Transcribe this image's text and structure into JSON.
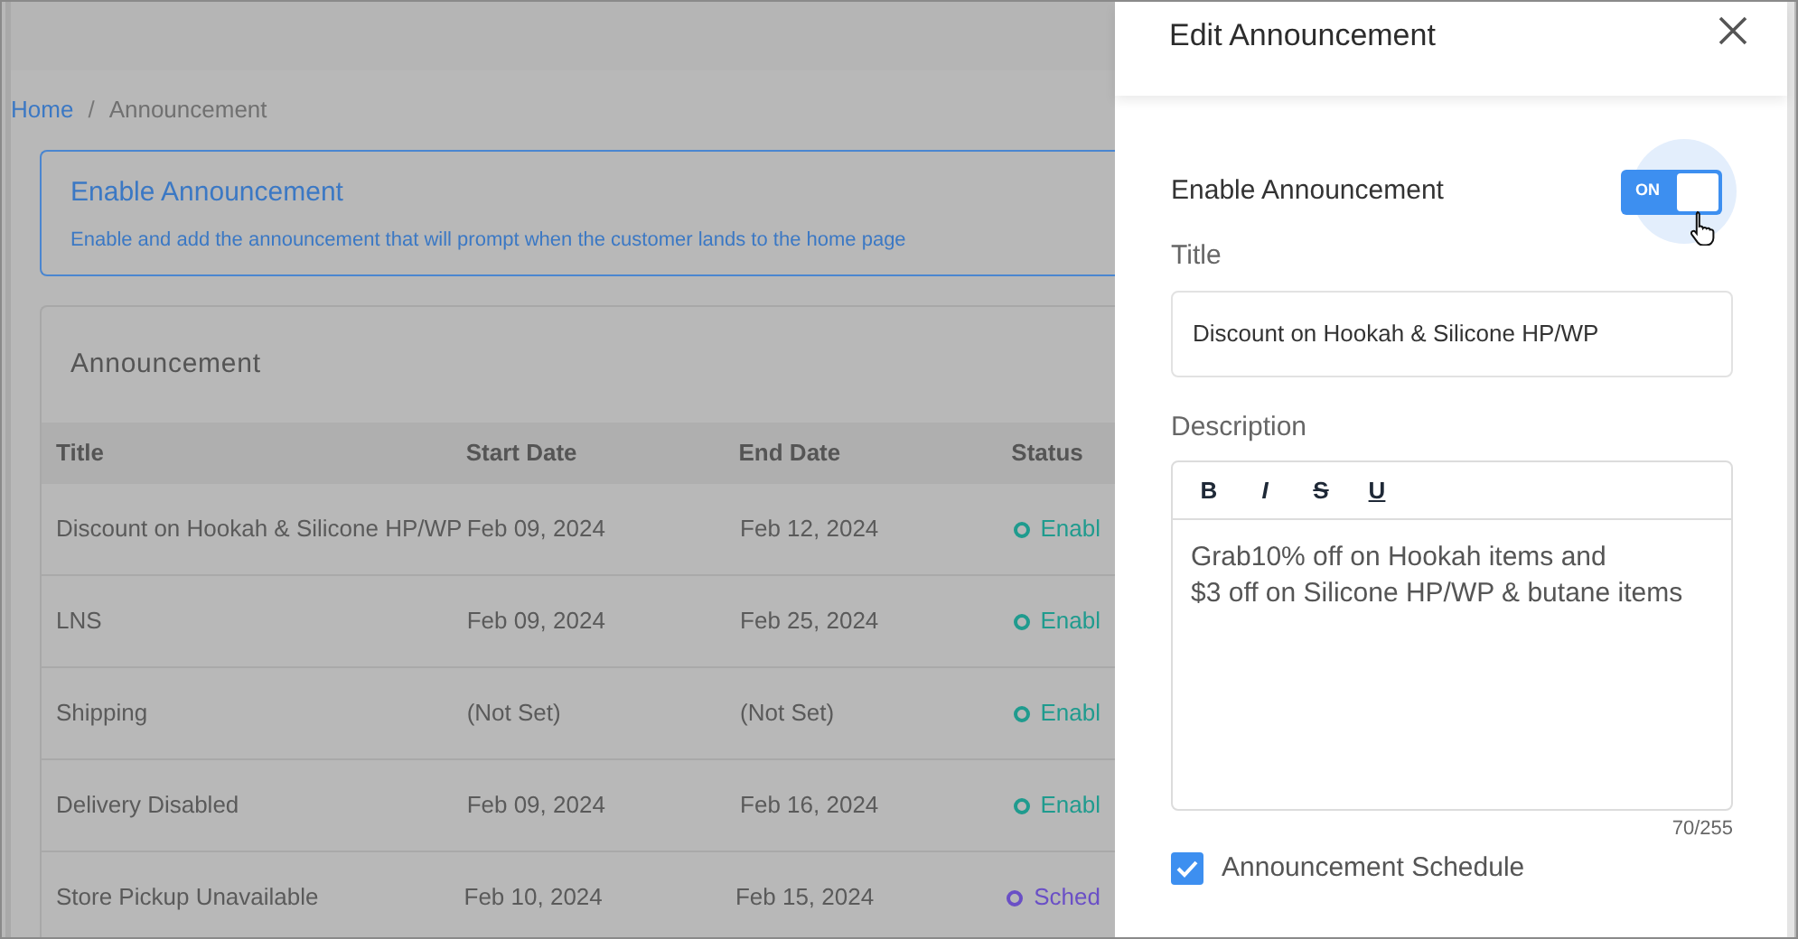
{
  "breadcrumb": [
    {
      "label": "Home",
      "kind": "link"
    },
    {
      "label": "/",
      "kind": "separator"
    },
    {
      "label": "Announcement",
      "kind": "current"
    }
  ],
  "info_card": {
    "title": "Enable Announcement",
    "text": "Enable and add the announcement that will prompt when the customer lands to the home page"
  },
  "table": {
    "title": "Announcement",
    "columns": [
      "Title",
      "Start Date",
      "End Date",
      "Status"
    ],
    "rows": [
      {
        "title": "Discount on Hookah & Silicone HP/WP",
        "start": "Feb 09, 2024",
        "end": "Feb 12, 2024",
        "status": "Enabl",
        "color": "#1f9b8e"
      },
      {
        "title": "LNS",
        "start": "Feb 09, 2024",
        "end": "Feb 25, 2024",
        "status": "Enabl",
        "color": "#1f9b8e"
      },
      {
        "title": "Shipping",
        "start": "(Not Set)",
        "end": "(Not Set)",
        "status": "Enabl",
        "color": "#1f9b8e"
      },
      {
        "title": "Delivery Disabled",
        "start": "Feb 09, 2024",
        "end": "Feb 16, 2024",
        "status": "Enabl",
        "color": "#1f9b8e"
      },
      {
        "title": "Store Pickup Unavailable",
        "start": "Feb 10, 2024",
        "end": "Feb 15, 2024",
        "status": "Sched",
        "color": "#6a4fc6"
      }
    ]
  },
  "panel": {
    "title": "Edit Announcement",
    "enable_label": "Enable Announcement",
    "toggle": {
      "on": true,
      "label": "ON"
    },
    "title_label": "Title",
    "title_value": "Discount on Hookah & Silicone HP/WP",
    "description_label": "Description",
    "toolbar": [
      "B",
      "I",
      "S",
      "U"
    ],
    "description_lines": [
      "Grab10% off on Hookah items and",
      "$3 off on Silicone HP/WP & butane items"
    ],
    "counter": "70/255",
    "schedule": {
      "label": "Announcement Schedule",
      "checked": true
    }
  }
}
